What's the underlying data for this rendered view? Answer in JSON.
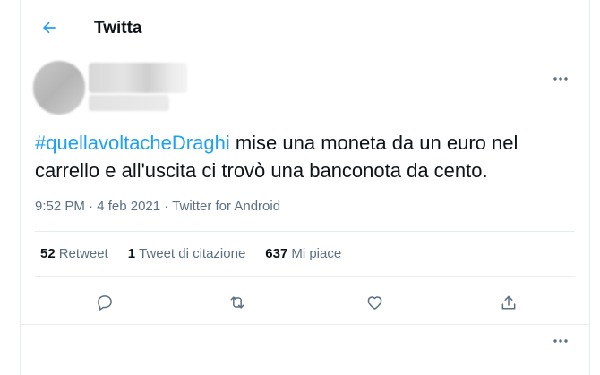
{
  "header": {
    "back_icon": "arrow-left-icon",
    "title": "Twitta"
  },
  "tweet": {
    "hashtag": "#quellavoltacheDraghi",
    "body": " mise una moneta da un euro nel carrello e all'uscita ci trovò una banconota da cento.",
    "timestamp": "9:52 PM · 4 feb 2021 · ",
    "source": "Twitter for Android",
    "more_icon": "more-horizontal-icon"
  },
  "stats": {
    "retweets_count": "52",
    "retweets_label": "Retweet",
    "quotes_count": "1",
    "quotes_label": "Tweet di citazione",
    "likes_count": "637",
    "likes_label": "Mi piace"
  },
  "actions": [
    {
      "name": "reply",
      "icon": "reply-icon"
    },
    {
      "name": "retweet",
      "icon": "retweet-icon"
    },
    {
      "name": "like",
      "icon": "heart-icon"
    },
    {
      "name": "share",
      "icon": "share-icon"
    }
  ],
  "colors": {
    "accent": "#1da1f2",
    "secondary_text": "#5b7083",
    "primary_text": "#0f1419",
    "border": "#e6ecf0"
  }
}
